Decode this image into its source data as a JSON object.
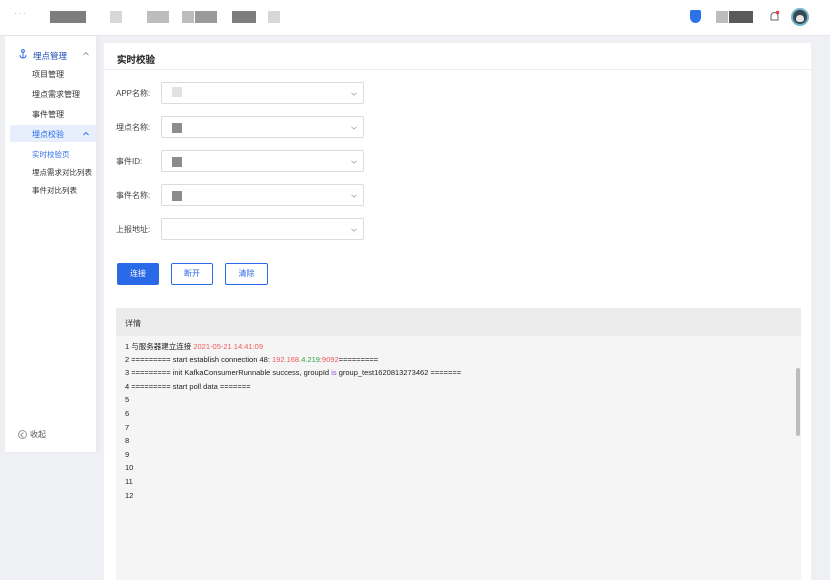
{
  "topbar": {
    "dots": "···"
  },
  "sidebar": {
    "group_label": "埋点管理",
    "items": [
      {
        "label": "项目管理"
      },
      {
        "label": "埋点需求管理"
      },
      {
        "label": "事件管理"
      }
    ],
    "active_group_label": "埋点校验",
    "sub_items": [
      {
        "label": "实时校验页",
        "active": true
      },
      {
        "label": "埋点需求对比列表",
        "active": false
      },
      {
        "label": "事件对比列表",
        "active": false
      }
    ],
    "collapse_label": "收起"
  },
  "panel": {
    "title": "实时校验",
    "form": [
      {
        "label": "APP名称:"
      },
      {
        "label": "埋点名称:"
      },
      {
        "label": "事件ID:"
      },
      {
        "label": "事件名称:"
      },
      {
        "label": "上报地址:"
      }
    ],
    "buttons": {
      "connect": "连接",
      "disconnect": "断开",
      "clear": "清除"
    },
    "detail": {
      "title": "详情",
      "lines": {
        "l1_prefix": "1 与服务器建立连接 ",
        "l1_date": "2021-05-21 14:41:09",
        "l2_prefix": "2 ========= start establish connection 48: ",
        "l2_ip_a": "192.168.",
        "l2_ip_b": "4.219",
        "l2_port": ":9092",
        "l2_suffix": "=========",
        "l3_prefix": "3 ========= init KafkaConsumerRunnable success, groupId ",
        "l3_is": "is",
        "l3_suffix": " group_test1620813273462 =======",
        "l4": "4 ========= start poll data =======",
        "l5": "5",
        "l6": "6",
        "l7": "7",
        "l8": "8",
        "l9": "9",
        "l10": "10",
        "l11": "11",
        "l12": "12"
      }
    }
  },
  "colors": {
    "primary": "#2a6ae8",
    "log_red": "#f05a5a",
    "log_green": "#2aa84a",
    "log_purple": "#9b4fd8"
  }
}
